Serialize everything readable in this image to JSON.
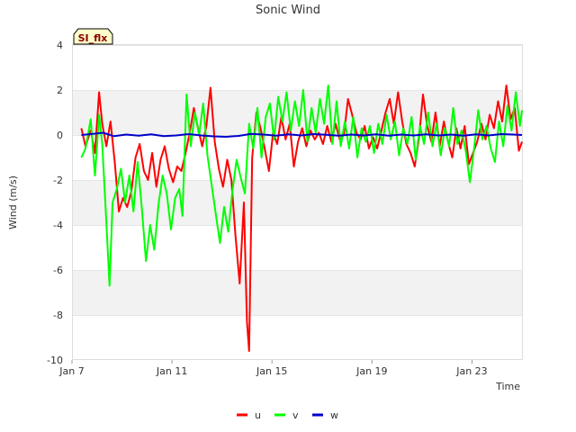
{
  "chart_data": {
    "type": "line",
    "title": "Sonic Wind",
    "badge": "SI_flx",
    "xlabel": "Time",
    "ylabel": "Wind (m/s)",
    "ylim": [
      -10,
      4
    ],
    "yticks": [
      4,
      2,
      0,
      -2,
      -4,
      -6,
      -8,
      -10
    ],
    "xlim": [
      "2024-01-07",
      "2024-01-25"
    ],
    "xticks": [
      {
        "date": "2024-01-07",
        "label": "Jan 7"
      },
      {
        "date": "2024-01-11",
        "label": "Jan 11"
      },
      {
        "date": "2024-01-15",
        "label": "Jan 15"
      },
      {
        "date": "2024-01-19",
        "label": "Jan 19"
      },
      {
        "date": "2024-01-23",
        "label": "Jan 23"
      }
    ],
    "grid": "horizontal bands",
    "legend": "bottom-center",
    "series": [
      {
        "name": "u",
        "color": "#ff0000",
        "points": [
          [
            "2024-01-07T09:00",
            0.3
          ],
          [
            "2024-01-07T13:00",
            -0.5
          ],
          [
            "2024-01-07T18:00",
            0.2
          ],
          [
            "2024-01-07T22:00",
            -0.8
          ],
          [
            "2024-01-08T02:00",
            1.9
          ],
          [
            "2024-01-08T05:00",
            0.5
          ],
          [
            "2024-01-08T09:00",
            -0.5
          ],
          [
            "2024-01-08T13:00",
            0.6
          ],
          [
            "2024-01-08T17:00",
            -1.2
          ],
          [
            "2024-01-08T21:00",
            -3.4
          ],
          [
            "2024-01-09T01:00",
            -2.8
          ],
          [
            "2024-01-09T05:00",
            -3.2
          ],
          [
            "2024-01-09T09:00",
            -2.5
          ],
          [
            "2024-01-09T13:00",
            -1.0
          ],
          [
            "2024-01-09T17:00",
            -0.4
          ],
          [
            "2024-01-09T21:00",
            -1.6
          ],
          [
            "2024-01-10T01:00",
            -2.0
          ],
          [
            "2024-01-10T05:00",
            -0.8
          ],
          [
            "2024-01-10T09:00",
            -2.3
          ],
          [
            "2024-01-10T13:00",
            -1.1
          ],
          [
            "2024-01-10T17:00",
            -0.5
          ],
          [
            "2024-01-10T21:00",
            -1.5
          ],
          [
            "2024-01-11T01:00",
            -2.1
          ],
          [
            "2024-01-11T05:00",
            -1.4
          ],
          [
            "2024-01-11T09:00",
            -1.6
          ],
          [
            "2024-01-11T13:00",
            -0.8
          ],
          [
            "2024-01-11T17:00",
            0.1
          ],
          [
            "2024-01-11T21:00",
            1.2
          ],
          [
            "2024-01-12T01:00",
            0.3
          ],
          [
            "2024-01-12T05:00",
            -0.5
          ],
          [
            "2024-01-12T09:00",
            0.4
          ],
          [
            "2024-01-12T13:00",
            2.1
          ],
          [
            "2024-01-12T17:00",
            -0.3
          ],
          [
            "2024-01-12T21:00",
            -1.5
          ],
          [
            "2024-01-13T01:00",
            -2.3
          ],
          [
            "2024-01-13T05:00",
            -1.1
          ],
          [
            "2024-01-13T09:00",
            -2.0
          ],
          [
            "2024-01-13T13:00",
            -4.5
          ],
          [
            "2024-01-13T17:00",
            -6.6
          ],
          [
            "2024-01-13T21:00",
            -3.0
          ],
          [
            "2024-01-14T00:00",
            -8.3
          ],
          [
            "2024-01-14T02:00",
            -9.6
          ],
          [
            "2024-01-14T05:00",
            -1.0
          ],
          [
            "2024-01-14T09:00",
            1.0
          ],
          [
            "2024-01-14T13:00",
            0.3
          ],
          [
            "2024-01-14T17:00",
            -0.6
          ],
          [
            "2024-01-14T21:00",
            -1.6
          ],
          [
            "2024-01-15T01:00",
            0.1
          ],
          [
            "2024-01-15T05:00",
            -0.4
          ],
          [
            "2024-01-15T09:00",
            0.8
          ],
          [
            "2024-01-15T13:00",
            -0.2
          ],
          [
            "2024-01-15T17:00",
            0.5
          ],
          [
            "2024-01-15T21:00",
            -1.4
          ],
          [
            "2024-01-16T01:00",
            -0.3
          ],
          [
            "2024-01-16T05:00",
            0.3
          ],
          [
            "2024-01-16T09:00",
            -0.5
          ],
          [
            "2024-01-16T13:00",
            0.2
          ],
          [
            "2024-01-16T17:00",
            -0.2
          ],
          [
            "2024-01-16T21:00",
            0.1
          ],
          [
            "2024-01-17T01:00",
            -0.4
          ],
          [
            "2024-01-17T05:00",
            0.4
          ],
          [
            "2024-01-17T09:00",
            -0.3
          ],
          [
            "2024-01-17T13:00",
            0.5
          ],
          [
            "2024-01-17T17:00",
            -0.2
          ],
          [
            "2024-01-17T21:00",
            0.0
          ],
          [
            "2024-01-18T01:00",
            1.6
          ],
          [
            "2024-01-18T05:00",
            0.9
          ],
          [
            "2024-01-18T09:00",
            0.1
          ],
          [
            "2024-01-18T13:00",
            -0.2
          ],
          [
            "2024-01-18T17:00",
            0.4
          ],
          [
            "2024-01-18T21:00",
            -0.6
          ],
          [
            "2024-01-19T01:00",
            -0.1
          ],
          [
            "2024-01-19T05:00",
            -0.6
          ],
          [
            "2024-01-19T09:00",
            0.2
          ],
          [
            "2024-01-19T13:00",
            1.0
          ],
          [
            "2024-01-19T17:00",
            1.6
          ],
          [
            "2024-01-19T21:00",
            0.5
          ],
          [
            "2024-01-20T01:00",
            1.9
          ],
          [
            "2024-01-20T05:00",
            0.6
          ],
          [
            "2024-01-20T09:00",
            -0.4
          ],
          [
            "2024-01-20T13:00",
            -0.8
          ],
          [
            "2024-01-20T17:00",
            -1.4
          ],
          [
            "2024-01-20T21:00",
            -0.2
          ],
          [
            "2024-01-21T01:00",
            1.8
          ],
          [
            "2024-01-21T05:00",
            0.4
          ],
          [
            "2024-01-21T09:00",
            -0.3
          ],
          [
            "2024-01-21T13:00",
            1.0
          ],
          [
            "2024-01-21T17:00",
            -0.5
          ],
          [
            "2024-01-21T21:00",
            0.6
          ],
          [
            "2024-01-22T01:00",
            -0.3
          ],
          [
            "2024-01-22T05:00",
            -1.0
          ],
          [
            "2024-01-22T09:00",
            0.3
          ],
          [
            "2024-01-22T13:00",
            -0.6
          ],
          [
            "2024-01-22T17:00",
            0.4
          ],
          [
            "2024-01-22T21:00",
            -1.3
          ],
          [
            "2024-01-23T01:00",
            -0.8
          ],
          [
            "2024-01-23T05:00",
            -0.3
          ],
          [
            "2024-01-23T09:00",
            0.5
          ],
          [
            "2024-01-23T13:00",
            -0.2
          ],
          [
            "2024-01-23T17:00",
            0.9
          ],
          [
            "2024-01-23T21:00",
            0.3
          ],
          [
            "2024-01-24T01:00",
            1.5
          ],
          [
            "2024-01-24T05:00",
            0.6
          ],
          [
            "2024-01-24T09:00",
            2.2
          ],
          [
            "2024-01-24T13:00",
            0.7
          ],
          [
            "2024-01-24T17:00",
            1.2
          ],
          [
            "2024-01-24T21:00",
            -0.7
          ],
          [
            "2024-01-25T00:00",
            -0.3
          ]
        ]
      },
      {
        "name": "v",
        "color": "#00ff00",
        "points": [
          [
            "2024-01-07T09:00",
            -1.0
          ],
          [
            "2024-01-07T13:00",
            -0.6
          ],
          [
            "2024-01-07T18:00",
            0.7
          ],
          [
            "2024-01-07T22:00",
            -1.8
          ],
          [
            "2024-01-08T02:00",
            0.9
          ],
          [
            "2024-01-08T05:00",
            -0.4
          ],
          [
            "2024-01-08T09:00",
            -3.9
          ],
          [
            "2024-01-08T12:00",
            -6.7
          ],
          [
            "2024-01-08T15:00",
            -3.0
          ],
          [
            "2024-01-08T19:00",
            -2.4
          ],
          [
            "2024-01-08T23:00",
            -1.5
          ],
          [
            "2024-01-09T03:00",
            -3.0
          ],
          [
            "2024-01-09T07:00",
            -1.8
          ],
          [
            "2024-01-09T11:00",
            -3.4
          ],
          [
            "2024-01-09T15:00",
            -1.2
          ],
          [
            "2024-01-09T19:00",
            -3.2
          ],
          [
            "2024-01-09T23:00",
            -5.6
          ],
          [
            "2024-01-10T03:00",
            -4.0
          ],
          [
            "2024-01-10T07:00",
            -5.1
          ],
          [
            "2024-01-10T11:00",
            -3.1
          ],
          [
            "2024-01-10T15:00",
            -1.8
          ],
          [
            "2024-01-10T19:00",
            -2.6
          ],
          [
            "2024-01-10T23:00",
            -4.2
          ],
          [
            "2024-01-11T03:00",
            -2.8
          ],
          [
            "2024-01-11T07:00",
            -2.4
          ],
          [
            "2024-01-11T10:00",
            -3.6
          ],
          [
            "2024-01-11T14:00",
            1.8
          ],
          [
            "2024-01-11T18:00",
            -0.5
          ],
          [
            "2024-01-11T22:00",
            1.0
          ],
          [
            "2024-01-12T02:00",
            0.0
          ],
          [
            "2024-01-12T06:00",
            1.4
          ],
          [
            "2024-01-12T10:00",
            -0.9
          ],
          [
            "2024-01-12T14:00",
            -2.2
          ],
          [
            "2024-01-12T18:00",
            -3.5
          ],
          [
            "2024-01-12T22:00",
            -4.8
          ],
          [
            "2024-01-13T02:00",
            -3.2
          ],
          [
            "2024-01-13T06:00",
            -4.3
          ],
          [
            "2024-01-13T10:00",
            -2.5
          ],
          [
            "2024-01-13T14:00",
            -1.1
          ],
          [
            "2024-01-13T18:00",
            -1.9
          ],
          [
            "2024-01-13T22:00",
            -2.6
          ],
          [
            "2024-01-14T02:00",
            0.5
          ],
          [
            "2024-01-14T06:00",
            -0.6
          ],
          [
            "2024-01-14T10:00",
            1.2
          ],
          [
            "2024-01-14T14:00",
            -1.0
          ],
          [
            "2024-01-14T18:00",
            0.8
          ],
          [
            "2024-01-14T22:00",
            1.4
          ],
          [
            "2024-01-15T02:00",
            -0.2
          ],
          [
            "2024-01-15T06:00",
            1.7
          ],
          [
            "2024-01-15T10:00",
            0.6
          ],
          [
            "2024-01-15T14:00",
            1.9
          ],
          [
            "2024-01-15T18:00",
            0.2
          ],
          [
            "2024-01-15T22:00",
            1.5
          ],
          [
            "2024-01-16T02:00",
            0.4
          ],
          [
            "2024-01-16T06:00",
            2.0
          ],
          [
            "2024-01-16T10:00",
            -0.3
          ],
          [
            "2024-01-16T14:00",
            1.2
          ],
          [
            "2024-01-16T18:00",
            0.1
          ],
          [
            "2024-01-16T22:00",
            1.6
          ],
          [
            "2024-01-17T02:00",
            0.5
          ],
          [
            "2024-01-17T06:00",
            2.2
          ],
          [
            "2024-01-17T10:00",
            -0.4
          ],
          [
            "2024-01-17T14:00",
            1.5
          ],
          [
            "2024-01-17T18:00",
            -0.5
          ],
          [
            "2024-01-17T22:00",
            0.6
          ],
          [
            "2024-01-18T02:00",
            -0.6
          ],
          [
            "2024-01-18T06:00",
            0.8
          ],
          [
            "2024-01-18T10:00",
            -1.0
          ],
          [
            "2024-01-18T14:00",
            0.3
          ],
          [
            "2024-01-18T18:00",
            -0.3
          ],
          [
            "2024-01-18T22:00",
            0.4
          ],
          [
            "2024-01-19T02:00",
            -0.8
          ],
          [
            "2024-01-19T06:00",
            0.5
          ],
          [
            "2024-01-19T10:00",
            -0.4
          ],
          [
            "2024-01-19T14:00",
            0.9
          ],
          [
            "2024-01-19T18:00",
            -0.2
          ],
          [
            "2024-01-19T22:00",
            0.6
          ],
          [
            "2024-01-20T02:00",
            -0.9
          ],
          [
            "2024-01-20T06:00",
            0.3
          ],
          [
            "2024-01-20T10:00",
            -0.4
          ],
          [
            "2024-01-20T14:00",
            0.8
          ],
          [
            "2024-01-20T18:00",
            -1.1
          ],
          [
            "2024-01-20T22:00",
            0.4
          ],
          [
            "2024-01-21T02:00",
            -0.4
          ],
          [
            "2024-01-21T06:00",
            1.0
          ],
          [
            "2024-01-21T10:00",
            -0.5
          ],
          [
            "2024-01-21T14:00",
            0.5
          ],
          [
            "2024-01-21T18:00",
            -0.9
          ],
          [
            "2024-01-21T22:00",
            0.3
          ],
          [
            "2024-01-22T02:00",
            -0.5
          ],
          [
            "2024-01-22T06:00",
            1.2
          ],
          [
            "2024-01-22T10:00",
            -0.4
          ],
          [
            "2024-01-22T14:00",
            0.2
          ],
          [
            "2024-01-22T18:00",
            -0.7
          ],
          [
            "2024-01-22T22:00",
            -2.1
          ],
          [
            "2024-01-23T02:00",
            -0.6
          ],
          [
            "2024-01-23T06:00",
            1.1
          ],
          [
            "2024-01-23T10:00",
            -0.2
          ],
          [
            "2024-01-23T14:00",
            0.4
          ],
          [
            "2024-01-23T18:00",
            -0.6
          ],
          [
            "2024-01-23T22:00",
            -1.2
          ],
          [
            "2024-01-24T02:00",
            0.6
          ],
          [
            "2024-01-24T06:00",
            -0.5
          ],
          [
            "2024-01-24T10:00",
            1.3
          ],
          [
            "2024-01-24T14:00",
            0.2
          ],
          [
            "2024-01-24T18:00",
            1.9
          ],
          [
            "2024-01-24T22:00",
            0.4
          ],
          [
            "2024-01-25T00:00",
            1.1
          ]
        ]
      },
      {
        "name": "w",
        "color": "#0000cc",
        "points": [
          [
            "2024-01-07T09:00",
            0.0
          ],
          [
            "2024-01-07T20:00",
            0.05
          ],
          [
            "2024-01-08T06:00",
            0.1
          ],
          [
            "2024-01-08T16:00",
            -0.05
          ],
          [
            "2024-01-09T04:00",
            0.02
          ],
          [
            "2024-01-09T16:00",
            -0.03
          ],
          [
            "2024-01-10T04:00",
            0.03
          ],
          [
            "2024-01-10T16:00",
            -0.05
          ],
          [
            "2024-01-11T04:00",
            -0.02
          ],
          [
            "2024-01-11T16:00",
            0.04
          ],
          [
            "2024-01-12T04:00",
            -0.02
          ],
          [
            "2024-01-12T16:00",
            -0.06
          ],
          [
            "2024-01-13T04:00",
            -0.08
          ],
          [
            "2024-01-13T16:00",
            -0.04
          ],
          [
            "2024-01-14T04:00",
            0.05
          ],
          [
            "2024-01-14T16:00",
            0.02
          ],
          [
            "2024-01-15T04:00",
            -0.03
          ],
          [
            "2024-01-15T16:00",
            0.03
          ],
          [
            "2024-01-16T04:00",
            -0.02
          ],
          [
            "2024-01-16T16:00",
            0.04
          ],
          [
            "2024-01-17T04:00",
            0.01
          ],
          [
            "2024-01-17T16:00",
            -0.03
          ],
          [
            "2024-01-18T04:00",
            0.02
          ],
          [
            "2024-01-18T16:00",
            -0.02
          ],
          [
            "2024-01-19T04:00",
            0.03
          ],
          [
            "2024-01-19T16:00",
            -0.03
          ],
          [
            "2024-01-20T04:00",
            0.02
          ],
          [
            "2024-01-20T16:00",
            -0.02
          ],
          [
            "2024-01-21T04:00",
            0.03
          ],
          [
            "2024-01-21T16:00",
            -0.02
          ],
          [
            "2024-01-22T04:00",
            0.02
          ],
          [
            "2024-01-22T16:00",
            -0.03
          ],
          [
            "2024-01-23T04:00",
            0.03
          ],
          [
            "2024-01-23T16:00",
            -0.02
          ],
          [
            "2024-01-24T04:00",
            0.04
          ],
          [
            "2024-01-24T16:00",
            0.02
          ],
          [
            "2024-01-25T00:00",
            0.0
          ]
        ]
      }
    ]
  }
}
